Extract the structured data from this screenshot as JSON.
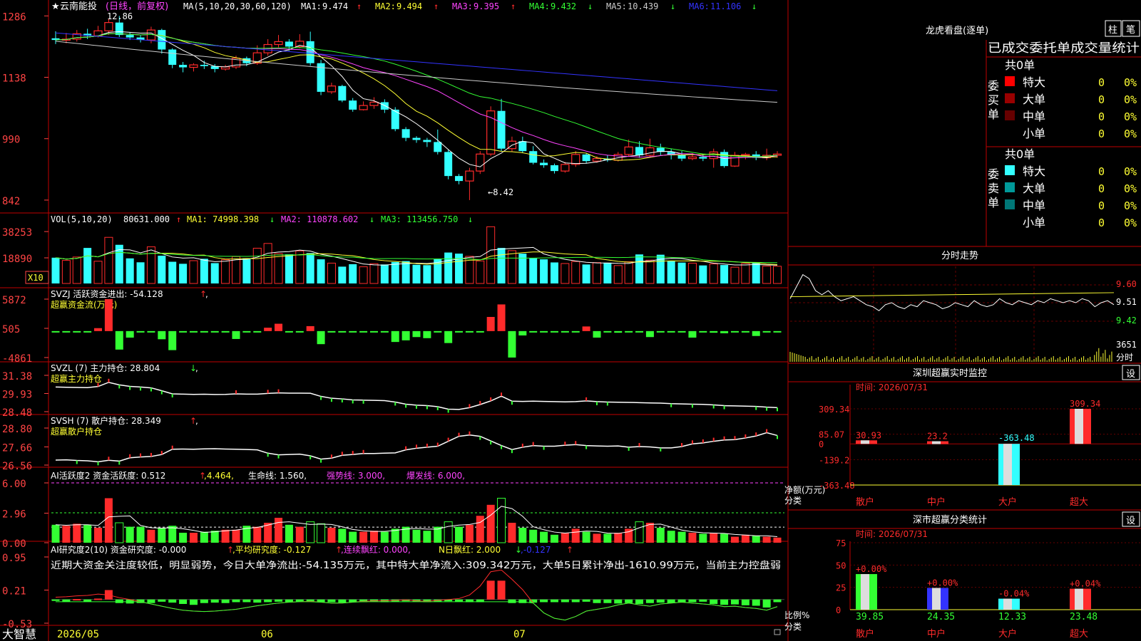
{
  "colors": {
    "bg": "#000000",
    "border": "#c00000",
    "up": "#ff2b2b",
    "down": "#33ffff",
    "green": "#33ff33",
    "yellow": "#ffff33",
    "magenta": "#ff44ff",
    "white": "#ffffff",
    "gray": "#bbbbbb",
    "blue": "#3333ff",
    "axis": "#ff4444"
  },
  "main": {
    "star": "★",
    "stock_name": "云南能投",
    "period": "(日线，前复权)",
    "ma_header": "MA(5,10,20,30,60,120)",
    "ma": [
      {
        "label": "MA1:",
        "value": "9.474",
        "arrow": "↑",
        "color": "#ffffff"
      },
      {
        "label": "MA2:",
        "value": "9.494",
        "arrow": "↑",
        "color": "#ffff33"
      },
      {
        "label": "MA3:",
        "value": "9.395",
        "arrow": "↑",
        "color": "#ff44ff"
      },
      {
        "label": "MA4:",
        "value": "9.432",
        "arrow": "↓",
        "color": "#33ff33"
      },
      {
        "label": "MA5:",
        "value": "10.439",
        "arrow": "↓",
        "color": "#cccccc"
      },
      {
        "label": "MA6:",
        "value": "11.106",
        "arrow": "↓",
        "color": "#3333ff"
      }
    ],
    "yaxis": [
      "1286",
      "1138",
      "990",
      "842"
    ],
    "high_label": "12.86",
    "low_label": "←8.42"
  },
  "vol": {
    "header": "VOL(5,10,20)",
    "value": "80631.000",
    "vu": "↑",
    "ma1": "MA1: 74998.398",
    "ma1u": "↓",
    "ma2": "MA2: 110878.602",
    "ma2u": "↓",
    "ma3": "MA3: 113456.750",
    "ma3u": "↓",
    "yaxis": [
      "38253",
      "18890"
    ],
    "unit": "X10"
  },
  "svzj": {
    "header": "SVZJ  活跃资金进出: -54.128",
    "hu": "↑",
    "comma": ",",
    "sub": "超赢资金流(万元)",
    "yaxis": [
      "5872",
      "505",
      "-4861"
    ]
  },
  "svzl": {
    "header": "SVZL (7) 主力持仓: 28.804",
    "hu": "↓",
    "comma": ",",
    "sub": "超赢主力持仓",
    "yaxis": [
      "31.38",
      "29.93",
      "28.48"
    ]
  },
  "svsh": {
    "header": "SVSH (7) 散户持仓: 28.349",
    "hu": "↑",
    "comma": ",",
    "sub": "超赢散户持仓",
    "yaxis": [
      "28.80",
      "27.66",
      "26.56"
    ]
  },
  "ai1": {
    "header": "AI活跃度2 资金活跃度: 0.512",
    "hu": "↑",
    "v2": ",4.464,",
    "life": "生命线: 1.560,",
    "strong": "强势线: 3.000,",
    "burst": "爆发线: 6.000,",
    "yaxis": [
      "6.00",
      "2.96",
      "0.00"
    ]
  },
  "ai2": {
    "header": "AI研究度2(10) 资金研究度: -0.000",
    "hu": "↑",
    "avg": ",平均研究度: -0.127",
    "avgu": "↑",
    "lx": ",连续飘红: 0.000,",
    "nr": "N日飘红: 2.000",
    "nru": "↓",
    "last": ",-0.127",
    "lastu": "↑",
    "note": "近期大资金关注度较低，明显弱势，今日大单净流出:-54.135万元，其中特大单净流入:309.342万元，大单5日累计净出-1610.99万元，当前主力控盘弱",
    "yaxis": [
      "0.95",
      "0.21",
      "-0.53"
    ]
  },
  "xaxis": {
    "brand": "大智慧",
    "labels": [
      "2026/05",
      "06",
      "07"
    ]
  },
  "right": {
    "lhb_title": "龙虎看盘(逐单)",
    "btn_zhu": "柱",
    "btn_bi": "笔",
    "tabs": "已成交委托单成交量统计",
    "buy_label": "委买单",
    "sell_label": "委卖单",
    "total": "共0单",
    "buy_rows": [
      {
        "name": "特大",
        "color": "#ff0000",
        "v": "0",
        "p": "0%"
      },
      {
        "name": "大单",
        "color": "#990000",
        "v": "0",
        "p": "0%"
      },
      {
        "name": "中单",
        "color": "#660000",
        "v": "0",
        "p": "0%"
      },
      {
        "name": "小单",
        "color": "",
        "v": "0",
        "p": "0%"
      }
    ],
    "sell_rows": [
      {
        "name": "特大",
        "color": "#33ffff",
        "v": "0",
        "p": "0%"
      },
      {
        "name": "大单",
        "color": "#009999",
        "v": "0",
        "p": "0%"
      },
      {
        "name": "中单",
        "color": "#007777",
        "v": "0",
        "p": "0%"
      },
      {
        "name": "小单",
        "color": "",
        "v": "0",
        "p": "0%"
      }
    ],
    "fs_title": "分时走势",
    "fs_yaxis": [
      "9.60",
      "9.51",
      "9.42"
    ],
    "fs_vol": "3651",
    "fs_unit": "分时",
    "sz_title": "深圳超赢实时监控",
    "sz_btn": "设",
    "sz_time": "时间: 2026/07/31",
    "sz_yaxis": [
      "309.34",
      "85.07",
      "0",
      "-139.2",
      "-363.48"
    ],
    "sz_unit1": "净额(万元)",
    "sz_unit2": "分类",
    "sz_bars": [
      {
        "name": "散户",
        "value": 30.93,
        "label": "30.93"
      },
      {
        "name": "中户",
        "value": 23.2,
        "label": "23.2"
      },
      {
        "name": "大户",
        "value": -363.48,
        "label": "-363.48"
      },
      {
        "name": "超大",
        "value": 309.34,
        "label": "309.34"
      }
    ],
    "sc_title": "深市超赢分类统计",
    "sc_btn": "设",
    "sc_time": "时间: 2026/07/31",
    "sc_yaxis": [
      "75",
      "50",
      "25",
      "0"
    ],
    "sc_unit1": "比例%",
    "sc_unit2": "分类",
    "sc_bars": [
      {
        "name": "散户",
        "value": 39.85,
        "chg": "+0.00%",
        "label": "39.85"
      },
      {
        "name": "中户",
        "value": 24.35,
        "chg": "+0.00%",
        "label": "24.35"
      },
      {
        "name": "大户",
        "value": 12.33,
        "chg": "-0.04%",
        "label": "12.33"
      },
      {
        "name": "超大",
        "value": 23.48,
        "chg": "+0.04%",
        "label": "23.48"
      }
    ]
  },
  "chart_data": {
    "type": "candlestick",
    "candles": [
      [
        12.32,
        12.28,
        12.49,
        12.18
      ],
      [
        12.28,
        12.3,
        12.45,
        12.2
      ],
      [
        12.3,
        12.43,
        12.52,
        12.24
      ],
      [
        12.43,
        12.38,
        12.55,
        12.3
      ],
      [
        12.38,
        12.5,
        12.62,
        12.34
      ],
      [
        12.5,
        12.7,
        12.8,
        12.4
      ],
      [
        12.7,
        12.4,
        12.86,
        12.35
      ],
      [
        12.4,
        12.34,
        12.46,
        12.28
      ],
      [
        12.34,
        12.28,
        12.4,
        12.22
      ],
      [
        12.28,
        12.52,
        12.6,
        12.2
      ],
      [
        12.52,
        12.05,
        12.55,
        11.95
      ],
      [
        12.05,
        11.68,
        12.08,
        11.6
      ],
      [
        11.68,
        11.62,
        11.75,
        11.5
      ],
      [
        11.62,
        11.68,
        11.72,
        11.52
      ],
      [
        11.68,
        11.65,
        11.78,
        11.58
      ],
      [
        11.65,
        11.58,
        11.7,
        11.5
      ],
      [
        11.58,
        11.63,
        11.68,
        11.54
      ],
      [
        11.63,
        11.84,
        11.9,
        11.58
      ],
      [
        11.84,
        11.72,
        11.88,
        11.65
      ],
      [
        11.72,
        11.97,
        12.15,
        11.68
      ],
      [
        11.97,
        12.17,
        12.3,
        11.9
      ],
      [
        12.17,
        12.24,
        12.4,
        12.1
      ],
      [
        12.24,
        12.12,
        12.3,
        12.02
      ],
      [
        12.12,
        12.25,
        12.42,
        12.08
      ],
      [
        12.25,
        11.72,
        12.48,
        11.66
      ],
      [
        11.72,
        11.03,
        11.8,
        10.95
      ],
      [
        11.03,
        11.17,
        11.25,
        10.98
      ],
      [
        11.17,
        10.82,
        11.2,
        10.78
      ],
      [
        10.82,
        10.6,
        10.88,
        10.55
      ],
      [
        10.6,
        10.7,
        10.8,
        10.58
      ],
      [
        10.7,
        10.78,
        10.9,
        10.62
      ],
      [
        10.78,
        10.6,
        10.85,
        10.52
      ],
      [
        10.6,
        10.13,
        10.66,
        10.08
      ],
      [
        10.13,
        9.92,
        10.18,
        9.84
      ],
      [
        9.92,
        9.87,
        9.96,
        9.8
      ],
      [
        9.87,
        9.82,
        9.92,
        9.7
      ],
      [
        9.82,
        9.58,
        10.12,
        9.52
      ],
      [
        9.58,
        9.0,
        9.64,
        8.92
      ],
      [
        9.0,
        8.88,
        9.05,
        8.8
      ],
      [
        8.88,
        9.12,
        9.2,
        8.42
      ],
      [
        9.12,
        9.53,
        9.6,
        9.05
      ],
      [
        9.53,
        10.57,
        10.68,
        9.48
      ],
      [
        10.57,
        9.66,
        10.86,
        9.6
      ],
      [
        9.66,
        9.84,
        9.95,
        9.58
      ],
      [
        9.84,
        9.6,
        9.95,
        9.55
      ],
      [
        9.6,
        9.32,
        9.72,
        9.28
      ],
      [
        9.32,
        9.26,
        9.4,
        9.2
      ],
      [
        9.26,
        9.12,
        9.3,
        9.06
      ],
      [
        9.12,
        9.28,
        9.34,
        9.08
      ],
      [
        9.28,
        9.52,
        9.6,
        9.22
      ],
      [
        9.52,
        9.36,
        9.55,
        9.3
      ],
      [
        9.36,
        9.42,
        9.48,
        9.32
      ],
      [
        9.42,
        9.38,
        9.5,
        9.34
      ],
      [
        9.38,
        9.52,
        9.58,
        9.35
      ],
      [
        9.52,
        9.7,
        9.88,
        9.46
      ],
      [
        9.7,
        9.5,
        9.84,
        9.44
      ],
      [
        9.5,
        9.68,
        9.9,
        9.45
      ],
      [
        9.68,
        9.58,
        9.78,
        9.5
      ],
      [
        9.58,
        9.5,
        9.66,
        9.4
      ],
      [
        9.5,
        9.42,
        9.6,
        9.36
      ],
      [
        9.42,
        9.46,
        9.55,
        9.38
      ],
      [
        9.46,
        9.42,
        9.52,
        9.36
      ],
      [
        9.42,
        9.58,
        9.66,
        9.2
      ],
      [
        9.58,
        9.24,
        9.64,
        9.2
      ],
      [
        9.24,
        9.5,
        9.58,
        9.22
      ],
      [
        9.5,
        9.52,
        9.56,
        9.4
      ],
      [
        9.52,
        9.44,
        9.6,
        9.38
      ],
      [
        9.44,
        9.5,
        9.66,
        9.38
      ],
      [
        9.5,
        9.53,
        9.6,
        9.44
      ]
    ],
    "volume": [
      19000,
      17000,
      19500,
      26200,
      16400,
      34000,
      28500,
      18500,
      15600,
      27000,
      20500,
      16000,
      14500,
      16800,
      18200,
      15000,
      17500,
      19800,
      18600,
      26000,
      29500,
      22000,
      21500,
      24000,
      22400,
      17800,
      15000,
      12400,
      14200,
      12300,
      14600,
      14000,
      15800,
      16500,
      13800,
      13500,
      18000,
      22800,
      22000,
      20000,
      16600,
      41800,
      26200,
      24200,
      22000,
      18800,
      17800,
      15500,
      14700,
      16200,
      14000,
      15400,
      15300,
      13200,
      16000,
      21400,
      17200,
      21200,
      16800,
      15400,
      15000,
      13300,
      14400,
      13600,
      12000,
      14800,
      15200,
      12800,
      12700
    ],
    "svzj": [
      -100,
      -180,
      -120,
      -90,
      540,
      5872,
      -3400,
      -1200,
      -150,
      -250,
      -1500,
      -3500,
      -200,
      -140,
      -100,
      -250,
      -120,
      -1450,
      -160,
      -140,
      620,
      1350,
      -200,
      -120,
      910,
      -2400,
      -160,
      -120,
      -180,
      -130,
      -140,
      -110,
      -2000,
      -1700,
      -1100,
      -1300,
      -190,
      -2200,
      -120,
      -120,
      -140,
      2600,
      4900,
      -4861,
      -800,
      -250,
      -160,
      -150,
      -200,
      -180,
      850,
      -1200,
      -150,
      -300,
      -180,
      -200,
      -1100,
      -250,
      -130,
      -200,
      -1200,
      -170,
      -300,
      -400,
      -200,
      -150,
      -900,
      -160,
      -130
    ],
    "svzl": [
      30.45,
      30.43,
      30.41,
      30.4,
      30.49,
      30.82,
      30.62,
      30.5,
      30.45,
      30.38,
      30.15,
      29.9,
      29.88,
      29.86,
      29.87,
      29.85,
      29.86,
      29.9,
      29.88,
      29.88,
      29.94,
      29.98,
      29.96,
      29.96,
      29.95,
      29.7,
      29.55,
      29.5,
      29.42,
      29.4,
      29.38,
      29.36,
      29.25,
      29.08,
      29.0,
      28.96,
      28.88,
      28.68,
      28.66,
      28.8,
      29.05,
      29.34,
      29.72,
      29.32,
      29.3,
      29.32,
      29.3,
      29.28,
      29.26,
      29.28,
      29.34,
      29.28,
      29.25,
      29.23,
      29.22,
      29.2,
      29.18,
      29.16,
      29.12,
      29.1,
      29.08,
      29.06,
      29.02,
      28.96,
      28.94,
      28.92,
      28.9,
      28.84,
      28.8
    ],
    "svsh": [
      26.86,
      26.88,
      26.84,
      26.82,
      26.76,
      26.85,
      26.8,
      27.0,
      27.05,
      27.08,
      27.2,
      27.52,
      27.53,
      27.52,
      27.54,
      27.55,
      27.53,
      27.52,
      27.5,
      27.48,
      27.28,
      27.18,
      27.2,
      27.22,
      27.12,
      26.92,
      26.98,
      27.15,
      27.2,
      27.26,
      27.26,
      27.28,
      27.3,
      27.48,
      27.58,
      27.64,
      27.7,
      28.0,
      28.3,
      28.38,
      28.3,
      28.02,
      27.74,
      27.5,
      27.64,
      27.74,
      27.7,
      27.7,
      27.76,
      27.8,
      27.74,
      27.72,
      27.7,
      27.72,
      27.64,
      27.68,
      27.66,
      27.6,
      27.6,
      27.68,
      27.84,
      27.9,
      28.0,
      28.08,
      28.1,
      28.2,
      28.32,
      28.52,
      28.35
    ],
    "ai_activity": [
      1.8,
      1.7,
      1.9,
      1.8,
      1.5,
      4.464,
      2.0,
      1.6,
      1.6,
      1.3,
      1.5,
      1.7,
      1.0,
      1.0,
      1.1,
      1.2,
      1.3,
      1.3,
      1.7,
      1.6,
      2.0,
      2.5,
      1.8,
      1.6,
      2.1,
      1.9,
      1.5,
      1.4,
      1.1,
      1.1,
      1.2,
      1.1,
      1.4,
      1.6,
      1.3,
      1.2,
      1.6,
      2.1,
      1.6,
      1.8,
      2.7,
      3.8,
      4.464,
      2.0,
      1.5,
      1.3,
      1.1,
      0.8,
      1.0,
      1.4,
      1.1,
      0.9,
      0.9,
      1.0,
      1.4,
      2.1,
      2.0,
      1.5,
      1.2,
      1.1,
      1.0,
      0.9,
      1.0,
      0.9,
      0.6,
      0.8,
      0.7,
      0.6,
      0.512
    ],
    "ai_research": [
      -0.02,
      -0.05,
      0.01,
      -0.05,
      0.02,
      0.21,
      -0.08,
      -0.09,
      -0.08,
      -0.08,
      -0.05,
      -0.07,
      -0.1,
      -0.12,
      -0.08,
      -0.07,
      -0.08,
      -0.06,
      -0.06,
      -0.07,
      -0.06,
      -0.05,
      -0.06,
      -0.05,
      -0.05,
      -0.06,
      -0.06,
      -0.07,
      -0.06,
      -0.06,
      -0.05,
      -0.06,
      -0.05,
      -0.04,
      -0.05,
      -0.06,
      -0.05,
      -0.04,
      -0.05,
      -0.06,
      -0.06,
      0.42,
      0.42,
      -0.08,
      -0.08,
      -0.07,
      -0.06,
      -0.06,
      -0.06,
      -0.06,
      -0.05,
      -0.08,
      -0.08,
      -0.09,
      -0.08,
      -0.1,
      -0.08,
      -0.07,
      -0.08,
      -0.06,
      -0.06,
      -0.05,
      -0.1,
      -0.12,
      -0.11,
      -0.13,
      -0.14,
      -0.18,
      -0.06
    ],
    "ai_research_line": [
      0.05,
      0.06,
      0.08,
      0.09,
      0.12,
      0.1,
      0.04,
      0.0,
      -0.05,
      -0.1,
      -0.15,
      -0.2,
      -0.24,
      -0.26,
      -0.27,
      -0.26,
      -0.24,
      -0.22,
      -0.18,
      -0.14,
      -0.11,
      -0.08,
      -0.06,
      -0.05,
      -0.04,
      -0.06,
      -0.08,
      -0.08,
      -0.06,
      -0.04,
      -0.03,
      -0.03,
      -0.02,
      -0.01,
      -0.03,
      -0.04,
      -0.02,
      0.0,
      0.02,
      0.1,
      0.3,
      0.62,
      0.66,
      0.45,
      0.22,
      -0.08,
      -0.3,
      -0.42,
      -0.46,
      -0.38,
      -0.26,
      -0.22,
      -0.18,
      -0.12,
      -0.08,
      -0.12,
      -0.15,
      -0.1,
      -0.08,
      -0.06,
      -0.08,
      -0.1,
      -0.12,
      -0.16,
      -0.15,
      -0.18,
      -0.2,
      -0.24,
      -0.16
    ],
    "intraday": [
      9.56,
      9.62,
      9.68,
      9.66,
      9.6,
      9.58,
      9.6,
      9.57,
      9.55,
      9.56,
      9.57,
      9.55,
      9.53,
      9.52,
      9.5,
      9.53,
      9.54,
      9.52,
      9.51,
      9.53,
      9.52,
      9.55,
      9.54,
      9.53,
      9.51,
      9.52,
      9.54,
      9.53,
      9.52,
      9.55,
      9.53,
      9.52,
      9.53,
      9.56,
      9.54,
      9.53,
      9.55,
      9.54,
      9.53,
      9.55,
      9.54,
      9.56,
      9.55,
      9.54,
      9.55,
      9.54,
      9.56,
      9.55,
      9.52,
      9.54,
      9.55,
      9.53
    ],
    "intraday_avg": 9.57
  }
}
